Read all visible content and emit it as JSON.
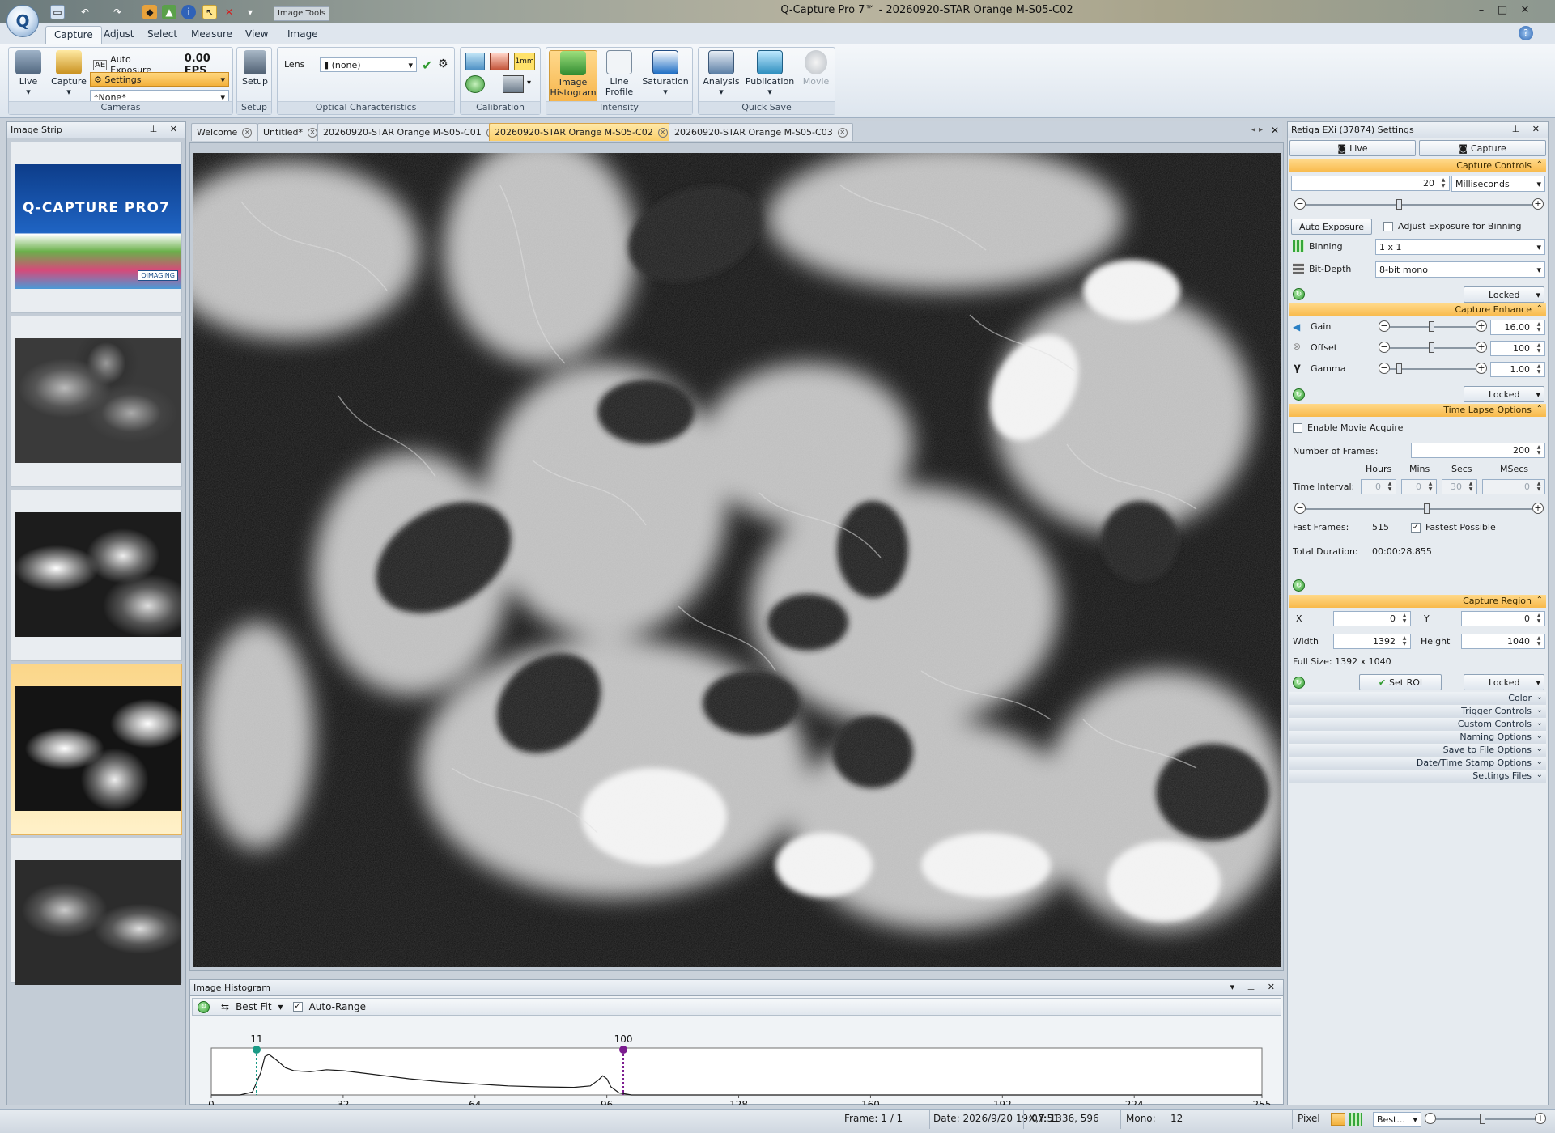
{
  "window": {
    "title": "Q-Capture Pro 7™ - 20260920-STAR Orange M-S05-C02",
    "context_tab": "Image Tools",
    "app_logo": "Q"
  },
  "ribbon": {
    "tabs": [
      "Capture",
      "Adjust",
      "Select",
      "Measure",
      "View",
      "Image"
    ],
    "active_tab": "Capture",
    "cameras": {
      "live_label": "Live",
      "capture_label": "Capture",
      "auto_exposure_label": "Auto Exposure",
      "fps": "0.00 FPS",
      "settings_label": "Settings",
      "preset_value": "*None*",
      "group_label": "Cameras"
    },
    "setup": {
      "button_label": "Setup",
      "group_label": "Setup"
    },
    "optical": {
      "lens_label": "Lens",
      "lens_value": "(none)",
      "group_label": "Optical Characteristics"
    },
    "calibration": {
      "group_label": "Calibration",
      "cal_value_label": "1mm"
    },
    "intensity": {
      "histogram_label_1": "Image",
      "histogram_label_2": "Histogram",
      "line_profile_1": "Line",
      "line_profile_2": "Profile",
      "saturation_label": "Saturation",
      "group_label": "Intensity"
    },
    "quicksave": {
      "analysis_label": "Analysis",
      "publication_label": "Publication",
      "movie_label": "Movie",
      "group_label": "Quick Save"
    }
  },
  "image_strip": {
    "title": "Image Strip",
    "splash_brand": "Q-CAPTURE PRO7",
    "splash_logo": "QIMAGING"
  },
  "doc_tabs": [
    {
      "label": "Welcome",
      "active": false
    },
    {
      "label": "Untitled*",
      "active": false
    },
    {
      "label": "20260920-STAR Orange M-S05-C01",
      "active": false
    },
    {
      "label": "20260920-STAR Orange M-S05-C02",
      "active": true
    },
    {
      "label": "20260920-STAR Orange M-S05-C03",
      "active": false
    }
  ],
  "histogram": {
    "title": "Image Histogram",
    "fit_label": "Best Fit",
    "auto_range_label": "Auto-Range",
    "auto_range_checked": true,
    "low_marker": 11,
    "high_marker": 100,
    "low_marker_color": "#1a9a86",
    "high_marker_color": "#7b1b8f",
    "x_ticks": [
      "0",
      "32",
      "64",
      "96",
      "128",
      "160",
      "192",
      "224",
      "255"
    ],
    "x_range": [
      0,
      255
    ]
  },
  "settings_panel": {
    "title": "Retiga EXi (37874) Settings",
    "live_button": "Live",
    "capture_button": "Capture",
    "capture_controls": {
      "header": "Capture Controls",
      "exposure_value": "20",
      "exposure_unit": "Milliseconds",
      "auto_exposure_button": "Auto Exposure",
      "adjust_binning_label": "Adjust Exposure for Binning",
      "binning_label": "Binning",
      "binning_value": "1 x 1",
      "bitdepth_label": "Bit-Depth",
      "bitdepth_value": "8-bit mono",
      "locked_label": "Locked"
    },
    "capture_enhance": {
      "header": "Capture Enhance",
      "gain_label": "Gain",
      "gain_value": "16.00",
      "offset_label": "Offset",
      "offset_value": "100",
      "gamma_label": "Gamma",
      "gamma_value": "1.00",
      "locked_label": "Locked"
    },
    "time_lapse": {
      "header": "Time Lapse Options",
      "enable_movie_label": "Enable Movie Acquire",
      "frames_label": "Number of Frames:",
      "frames_value": "200",
      "col_hours": "Hours",
      "col_mins": "Mins",
      "col_secs": "Secs",
      "col_msecs": "MSecs",
      "interval_label": "Time Interval:",
      "hours_value": "0",
      "mins_value": "0",
      "secs_value": "30",
      "msecs_value": "0",
      "fast_frames_label": "Fast Frames:",
      "fast_frames_value": "515",
      "fastest_label": "Fastest Possible",
      "total_duration_label": "Total Duration:",
      "total_duration_value": "00:00:28.855"
    },
    "capture_region": {
      "header": "Capture Region",
      "x_label": "X",
      "x_value": "0",
      "y_label": "Y",
      "y_value": "0",
      "width_label": "Width",
      "width_value": "1392",
      "height_label": "Height",
      "height_value": "1040",
      "full_size": "Full Size: 1392 x 1040",
      "set_roi_button": "Set ROI",
      "locked_label": "Locked"
    },
    "collapsed_sections": [
      "Color",
      "Trigger Controls",
      "Custom Controls",
      "Naming Options",
      "Save to File Options",
      "Date/Time Stamp Options",
      "Settings Files"
    ]
  },
  "status_bar": {
    "frame": "Frame: 1 / 1",
    "date": "Date: 2026/9/20 19:07:51",
    "xy": "X,Y: 1336,  596",
    "mono_label": "Mono:",
    "mono_value": "12",
    "unit": "Pixel",
    "zoom": "Best..."
  }
}
